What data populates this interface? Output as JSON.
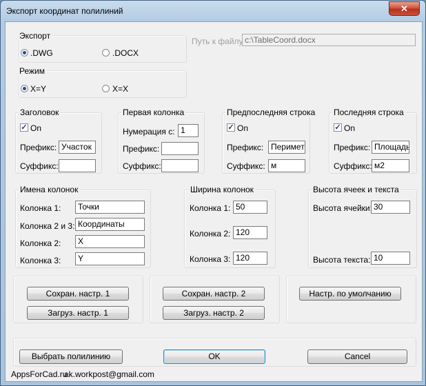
{
  "window": {
    "title": "Экспорт координат полилиний",
    "close_glyph": "✕"
  },
  "export": {
    "title": "Экспорт",
    "options": [
      {
        "label": ".DWG",
        "checked": true
      },
      {
        "label": ".DOCX",
        "checked": false
      }
    ]
  },
  "filepath": {
    "label": "Путь к файлу",
    "value": "c:\\TableCoord.docx"
  },
  "mode": {
    "title": "Режим",
    "options": [
      {
        "label": "X=Y",
        "checked": true
      },
      {
        "label": "X=X",
        "checked": false
      }
    ]
  },
  "header_group": {
    "title": "Заголовок",
    "on_label": "On",
    "prefix_label": "Префикс:",
    "prefix_value": "Участок",
    "suffix_label": "Суффикс:",
    "suffix_value": ""
  },
  "first_column": {
    "title": "Первая колонка",
    "numbering_label": "Нумерация с:",
    "numbering_value": "1",
    "prefix_label": "Префикс:",
    "prefix_value": "",
    "suffix_label": "Суффикс:",
    "suffix_value": ""
  },
  "penultimate_row": {
    "title": "Предпоследняя строка",
    "on_label": "On",
    "prefix_label": "Префикс:",
    "prefix_value": "Периметр",
    "suffix_label": "Суффикс:",
    "suffix_value": "м"
  },
  "last_row": {
    "title": "Последняя строка",
    "on_label": "On",
    "prefix_label": "Префикс:",
    "prefix_value": "Площадь:",
    "suffix_label": "Суффикс:",
    "suffix_value": "м2"
  },
  "column_names": {
    "title": "Имена колонок",
    "rows": [
      {
        "label": "Колонка 1:",
        "value": "Точки"
      },
      {
        "label": "Колонка 2 и 3:",
        "value": "Координаты"
      },
      {
        "label": "Колонка 2:",
        "value": "X"
      },
      {
        "label": "Колонка 3:",
        "value": "Y"
      }
    ]
  },
  "column_widths": {
    "title": "Ширина колонок",
    "rows": [
      {
        "label": "Колонка 1:",
        "value": "50"
      },
      {
        "label": "Колонка 2:",
        "value": "120"
      },
      {
        "label": "Колонка 3:",
        "value": "120"
      }
    ]
  },
  "cell_height": {
    "title": "Высота ячеек и текста",
    "cell_label": "Высота ячейки:",
    "cell_value": "30",
    "text_label": "Высота текста:",
    "text_value": "10"
  },
  "settings_buttons": {
    "save1": "Сохран. настр. 1",
    "load1": "Загруз. настр. 1",
    "save2": "Сохран. настр. 2",
    "load2": "Загруз. настр. 2",
    "defaults": "Настр. по умолчанию"
  },
  "footer": {
    "select_polyline": "Выбрать полилинию",
    "ok": "OK",
    "cancel": "Cancel",
    "site": "AppsForCad.ru",
    "email": "ak.workpost@gmail.com"
  }
}
